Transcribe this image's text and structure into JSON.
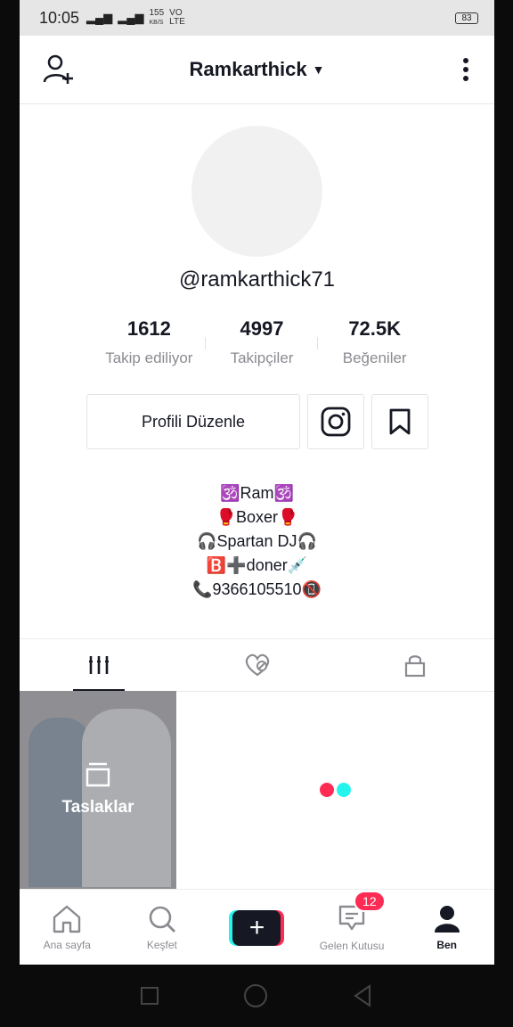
{
  "status_bar": {
    "time": "10:05",
    "network_speed": "155",
    "speed_unit": "KB/S",
    "carrier": "VO LTE",
    "battery": "83"
  },
  "header": {
    "username": "Ramkarthick",
    "add_user_icon": "person-plus-icon",
    "menu_icon": "kebab-icon"
  },
  "profile": {
    "handle": "@ramkarthick71",
    "stats": [
      {
        "value": "1612",
        "label": "Takip ediliyor"
      },
      {
        "value": "4997",
        "label": "Takipçiler"
      },
      {
        "value": "72.5K",
        "label": "Beğeniler"
      }
    ],
    "edit_button": "Profili Düzenle",
    "bio": [
      "🕉️Ram🕉️",
      "🥊Boxer🥊",
      "🎧Spartan DJ🎧",
      "🅱️➕doner💉",
      "📞9366105510📵"
    ]
  },
  "tabs": [
    "videos-grid-icon",
    "liked-hidden-icon",
    "lock-icon"
  ],
  "grid": {
    "draft_label": "Taslaklar"
  },
  "nav": {
    "items": [
      "Ana sayfa",
      "Keşfet",
      "",
      "Gelen Kutusu",
      "Ben"
    ],
    "inbox_badge": "12"
  },
  "colors": {
    "accent_red": "#fe2c55",
    "accent_cyan": "#25f4ee",
    "text_primary": "#161823"
  }
}
